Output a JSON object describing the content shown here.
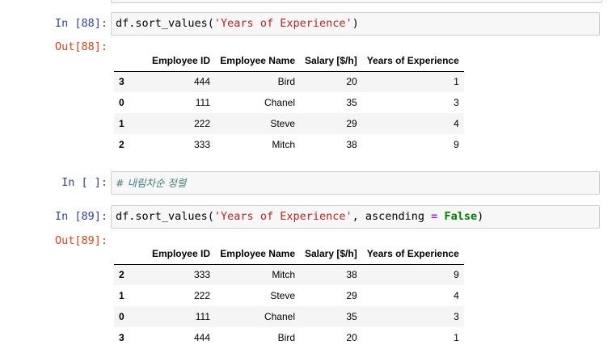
{
  "cells": [
    {
      "in_prompt": "In [88]:",
      "code": {
        "head": "df.sort_values(",
        "arg": "'Years of Experience'",
        "tail": ")"
      },
      "out_prompt": "Out[88]:",
      "table": {
        "columns": [
          "",
          "Employee ID",
          "Employee Name",
          "Salary [$/h]",
          "Years of Experience"
        ],
        "rows": [
          {
            "index": "3",
            "id": "444",
            "name": "Bird",
            "salary": "20",
            "years": "1"
          },
          {
            "index": "0",
            "id": "111",
            "name": "Chanel",
            "salary": "35",
            "years": "3"
          },
          {
            "index": "1",
            "id": "222",
            "name": "Steve",
            "salary": "29",
            "years": "4"
          },
          {
            "index": "2",
            "id": "333",
            "name": "Mitch",
            "salary": "38",
            "years": "9"
          }
        ]
      }
    },
    {
      "in_prompt": "In [ ]:",
      "comment": "# 내림차순 정렬"
    },
    {
      "in_prompt": "In [89]:",
      "code": {
        "head": "df.sort_values(",
        "arg": "'Years of Experience'",
        "mid": ", ascending ",
        "op": "=",
        "space": " ",
        "kw": "False",
        "tail": ")"
      },
      "out_prompt": "Out[89]:",
      "table": {
        "columns": [
          "",
          "Employee ID",
          "Employee Name",
          "Salary [$/h]",
          "Years of Experience"
        ],
        "rows": [
          {
            "index": "2",
            "id": "333",
            "name": "Mitch",
            "salary": "38",
            "years": "9"
          },
          {
            "index": "1",
            "id": "222",
            "name": "Steve",
            "salary": "29",
            "years": "4"
          },
          {
            "index": "0",
            "id": "111",
            "name": "Chanel",
            "salary": "35",
            "years": "3"
          },
          {
            "index": "3",
            "id": "444",
            "name": "Bird",
            "salary": "20",
            "years": "1"
          }
        ]
      }
    }
  ]
}
